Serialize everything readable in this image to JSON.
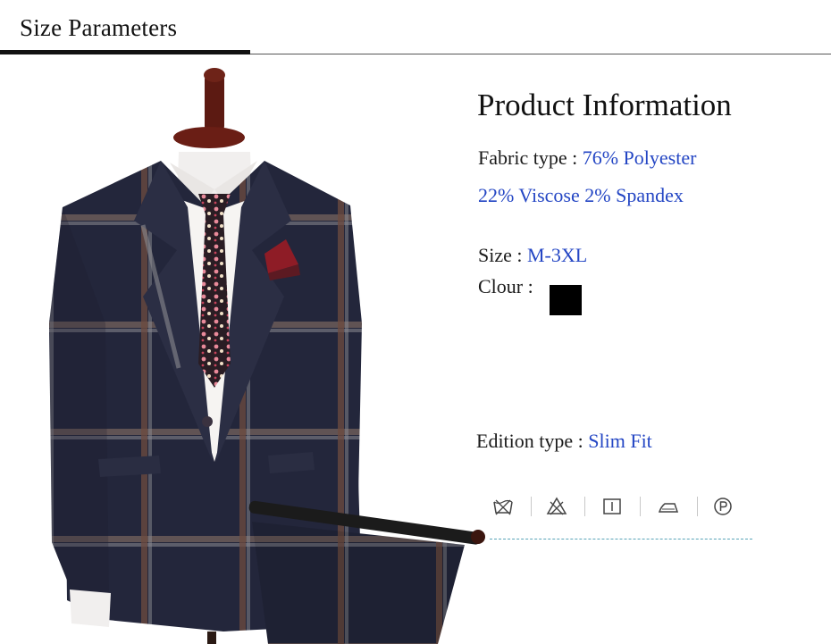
{
  "header": {
    "title": "Size Parameters"
  },
  "product": {
    "heading": "Product Information",
    "fabric_label": "Fabric type : ",
    "fabric_value_line1": "76% Polyester",
    "fabric_value_line2": "22% Viscose 2% Spandex",
    "size_label": "Size : ",
    "size_value": "M-3XL",
    "colour_label": "Clour : ",
    "colour_swatch": "#000000",
    "edition_label": "Edition type : ",
    "edition_value": "Slim Fit"
  },
  "care_icons": [
    "do-not-wash-icon",
    "do-not-bleach-icon",
    "tumble-dry-icon",
    "iron-icon",
    "professional-dry-clean-icon"
  ],
  "colors": {
    "value_text": "#2446c4",
    "header_bar": "#111111",
    "suit": "#22253a"
  }
}
